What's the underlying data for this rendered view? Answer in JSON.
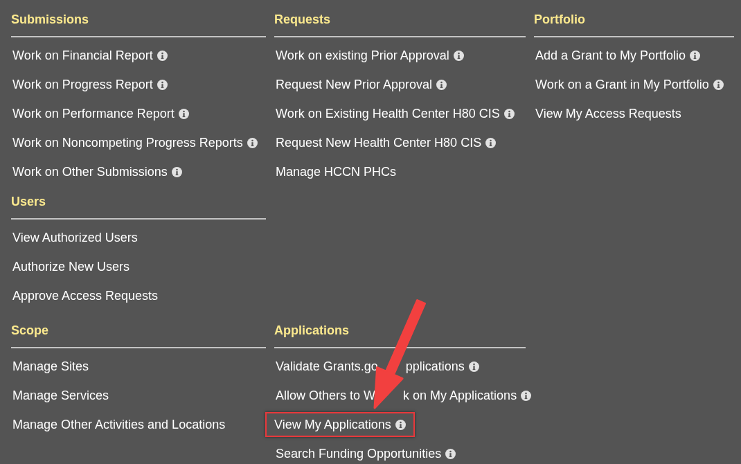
{
  "rows": [
    {
      "columns": [
        {
          "sections": [
            {
              "title": "Submissions",
              "items": [
                {
                  "label": "Work on Financial Report",
                  "info": true,
                  "highlighted": false
                },
                {
                  "label": "Work on Progress Report",
                  "info": true,
                  "highlighted": false
                },
                {
                  "label": "Work on Performance Report",
                  "info": true,
                  "highlighted": false
                },
                {
                  "label": "Work on Noncompeting Progress Reports",
                  "info": true,
                  "highlighted": false
                },
                {
                  "label": "Work on Other Submissions",
                  "info": true,
                  "highlighted": false
                }
              ]
            },
            {
              "title": "Users",
              "items": [
                {
                  "label": "View Authorized Users",
                  "info": false,
                  "highlighted": false
                },
                {
                  "label": "Authorize New Users",
                  "info": false,
                  "highlighted": false
                },
                {
                  "label": "Approve Access Requests",
                  "info": false,
                  "highlighted": false
                }
              ]
            }
          ]
        },
        {
          "sections": [
            {
              "title": "Requests",
              "items": [
                {
                  "label": "Work on existing Prior Approval",
                  "info": true,
                  "highlighted": false
                },
                {
                  "label": "Request New Prior Approval",
                  "info": true,
                  "highlighted": false
                },
                {
                  "label": "Work on Existing Health Center H80 CIS",
                  "info": true,
                  "highlighted": false
                },
                {
                  "label": "Request New Health Center H80 CIS",
                  "info": true,
                  "highlighted": false
                },
                {
                  "label": "Manage HCCN PHCs",
                  "info": false,
                  "highlighted": false
                }
              ]
            }
          ]
        },
        {
          "sections": [
            {
              "title": "Portfolio",
              "items": [
                {
                  "label": "Add a Grant to My Portfolio",
                  "info": true,
                  "highlighted": false
                },
                {
                  "label": "Work on a Grant in My Portfolio",
                  "info": true,
                  "highlighted": false
                },
                {
                  "label": "View My Access Requests",
                  "info": false,
                  "highlighted": false
                }
              ]
            }
          ]
        }
      ]
    },
    {
      "columns": [
        {
          "sections": [
            {
              "title": "Scope",
              "items": [
                {
                  "label": "Manage Sites",
                  "info": false,
                  "highlighted": false
                },
                {
                  "label": "Manage Services",
                  "info": false,
                  "highlighted": false
                },
                {
                  "label": "Manage Other Activities and Locations",
                  "info": false,
                  "highlighted": false
                }
              ]
            }
          ]
        },
        {
          "sections": [
            {
              "title": "Applications",
              "items": [
                {
                  "label_parts": [
                    "Validate Grants.go",
                    "pplications"
                  ],
                  "info": true,
                  "highlighted": false
                },
                {
                  "label_parts": [
                    "Allow Others to W",
                    "k on My Applications"
                  ],
                  "info": true,
                  "highlighted": false
                },
                {
                  "label": "View My Applications",
                  "info": true,
                  "highlighted": true
                },
                {
                  "label": "Search Funding Opportunities",
                  "info": true,
                  "highlighted": false
                }
              ]
            }
          ]
        }
      ]
    }
  ]
}
